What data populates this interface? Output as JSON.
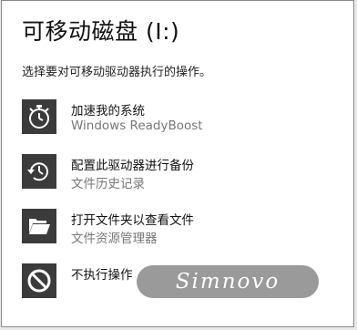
{
  "dialog": {
    "title": "可移动磁盘 (I:)",
    "subtitle": "选择要对可移动驱动器执行的操作。"
  },
  "options": [
    {
      "label": "加速我的系统",
      "description": "Windows ReadyBoost",
      "icon": "stopwatch-icon"
    },
    {
      "label": "配置此驱动器进行备份",
      "description": "文件历史记录",
      "icon": "history-clock-icon"
    },
    {
      "label": "打开文件夹以查看文件",
      "description": "文件资源管理器",
      "icon": "folder-open-icon"
    },
    {
      "label": "不执行操作",
      "description": "",
      "icon": "no-action-icon"
    }
  ],
  "watermark": {
    "text": "Simnovo"
  },
  "colors": {
    "tile": "#3b3b3b",
    "description": "#777777",
    "watermark_bg": "#9a9a9a"
  }
}
